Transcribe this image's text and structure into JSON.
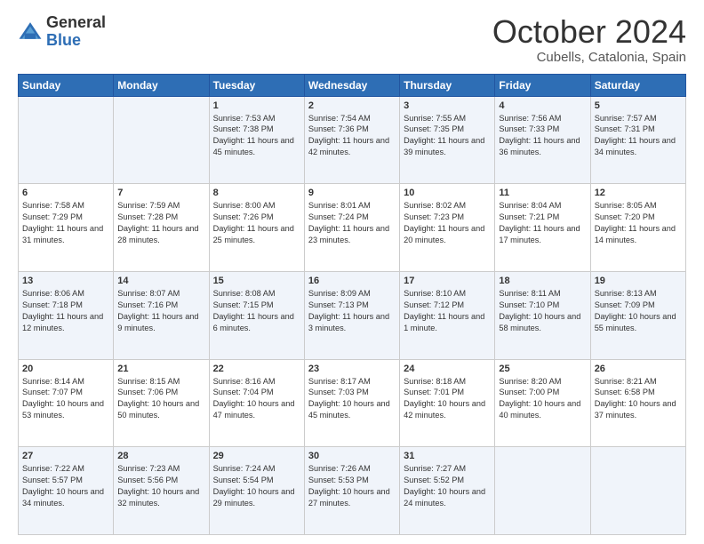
{
  "header": {
    "logo_general": "General",
    "logo_blue": "Blue",
    "month": "October 2024",
    "location": "Cubells, Catalonia, Spain"
  },
  "days_of_week": [
    "Sunday",
    "Monday",
    "Tuesday",
    "Wednesday",
    "Thursday",
    "Friday",
    "Saturday"
  ],
  "weeks": [
    [
      {
        "num": "",
        "info": ""
      },
      {
        "num": "",
        "info": ""
      },
      {
        "num": "1",
        "info": "Sunrise: 7:53 AM\nSunset: 7:38 PM\nDaylight: 11 hours and 45 minutes."
      },
      {
        "num": "2",
        "info": "Sunrise: 7:54 AM\nSunset: 7:36 PM\nDaylight: 11 hours and 42 minutes."
      },
      {
        "num": "3",
        "info": "Sunrise: 7:55 AM\nSunset: 7:35 PM\nDaylight: 11 hours and 39 minutes."
      },
      {
        "num": "4",
        "info": "Sunrise: 7:56 AM\nSunset: 7:33 PM\nDaylight: 11 hours and 36 minutes."
      },
      {
        "num": "5",
        "info": "Sunrise: 7:57 AM\nSunset: 7:31 PM\nDaylight: 11 hours and 34 minutes."
      }
    ],
    [
      {
        "num": "6",
        "info": "Sunrise: 7:58 AM\nSunset: 7:29 PM\nDaylight: 11 hours and 31 minutes."
      },
      {
        "num": "7",
        "info": "Sunrise: 7:59 AM\nSunset: 7:28 PM\nDaylight: 11 hours and 28 minutes."
      },
      {
        "num": "8",
        "info": "Sunrise: 8:00 AM\nSunset: 7:26 PM\nDaylight: 11 hours and 25 minutes."
      },
      {
        "num": "9",
        "info": "Sunrise: 8:01 AM\nSunset: 7:24 PM\nDaylight: 11 hours and 23 minutes."
      },
      {
        "num": "10",
        "info": "Sunrise: 8:02 AM\nSunset: 7:23 PM\nDaylight: 11 hours and 20 minutes."
      },
      {
        "num": "11",
        "info": "Sunrise: 8:04 AM\nSunset: 7:21 PM\nDaylight: 11 hours and 17 minutes."
      },
      {
        "num": "12",
        "info": "Sunrise: 8:05 AM\nSunset: 7:20 PM\nDaylight: 11 hours and 14 minutes."
      }
    ],
    [
      {
        "num": "13",
        "info": "Sunrise: 8:06 AM\nSunset: 7:18 PM\nDaylight: 11 hours and 12 minutes."
      },
      {
        "num": "14",
        "info": "Sunrise: 8:07 AM\nSunset: 7:16 PM\nDaylight: 11 hours and 9 minutes."
      },
      {
        "num": "15",
        "info": "Sunrise: 8:08 AM\nSunset: 7:15 PM\nDaylight: 11 hours and 6 minutes."
      },
      {
        "num": "16",
        "info": "Sunrise: 8:09 AM\nSunset: 7:13 PM\nDaylight: 11 hours and 3 minutes."
      },
      {
        "num": "17",
        "info": "Sunrise: 8:10 AM\nSunset: 7:12 PM\nDaylight: 11 hours and 1 minute."
      },
      {
        "num": "18",
        "info": "Sunrise: 8:11 AM\nSunset: 7:10 PM\nDaylight: 10 hours and 58 minutes."
      },
      {
        "num": "19",
        "info": "Sunrise: 8:13 AM\nSunset: 7:09 PM\nDaylight: 10 hours and 55 minutes."
      }
    ],
    [
      {
        "num": "20",
        "info": "Sunrise: 8:14 AM\nSunset: 7:07 PM\nDaylight: 10 hours and 53 minutes."
      },
      {
        "num": "21",
        "info": "Sunrise: 8:15 AM\nSunset: 7:06 PM\nDaylight: 10 hours and 50 minutes."
      },
      {
        "num": "22",
        "info": "Sunrise: 8:16 AM\nSunset: 7:04 PM\nDaylight: 10 hours and 47 minutes."
      },
      {
        "num": "23",
        "info": "Sunrise: 8:17 AM\nSunset: 7:03 PM\nDaylight: 10 hours and 45 minutes."
      },
      {
        "num": "24",
        "info": "Sunrise: 8:18 AM\nSunset: 7:01 PM\nDaylight: 10 hours and 42 minutes."
      },
      {
        "num": "25",
        "info": "Sunrise: 8:20 AM\nSunset: 7:00 PM\nDaylight: 10 hours and 40 minutes."
      },
      {
        "num": "26",
        "info": "Sunrise: 8:21 AM\nSunset: 6:58 PM\nDaylight: 10 hours and 37 minutes."
      }
    ],
    [
      {
        "num": "27",
        "info": "Sunrise: 7:22 AM\nSunset: 5:57 PM\nDaylight: 10 hours and 34 minutes."
      },
      {
        "num": "28",
        "info": "Sunrise: 7:23 AM\nSunset: 5:56 PM\nDaylight: 10 hours and 32 minutes."
      },
      {
        "num": "29",
        "info": "Sunrise: 7:24 AM\nSunset: 5:54 PM\nDaylight: 10 hours and 29 minutes."
      },
      {
        "num": "30",
        "info": "Sunrise: 7:26 AM\nSunset: 5:53 PM\nDaylight: 10 hours and 27 minutes."
      },
      {
        "num": "31",
        "info": "Sunrise: 7:27 AM\nSunset: 5:52 PM\nDaylight: 10 hours and 24 minutes."
      },
      {
        "num": "",
        "info": ""
      },
      {
        "num": "",
        "info": ""
      }
    ]
  ]
}
